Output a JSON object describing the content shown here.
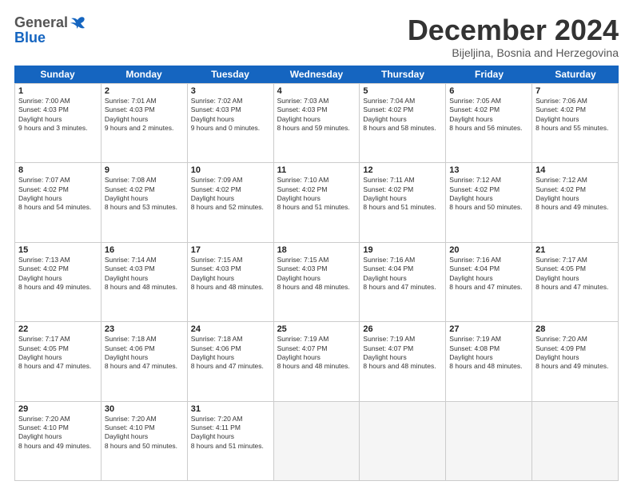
{
  "header": {
    "logo_general": "General",
    "logo_blue": "Blue",
    "month_title": "December 2024",
    "subtitle": "Bijeljina, Bosnia and Herzegovina"
  },
  "days_of_week": [
    "Sunday",
    "Monday",
    "Tuesday",
    "Wednesday",
    "Thursday",
    "Friday",
    "Saturday"
  ],
  "weeks": [
    [
      {
        "day": 1,
        "sunrise": "7:00 AM",
        "sunset": "4:03 PM",
        "daylight": "9 hours and 3 minutes."
      },
      {
        "day": 2,
        "sunrise": "7:01 AM",
        "sunset": "4:03 PM",
        "daylight": "9 hours and 2 minutes."
      },
      {
        "day": 3,
        "sunrise": "7:02 AM",
        "sunset": "4:03 PM",
        "daylight": "9 hours and 0 minutes."
      },
      {
        "day": 4,
        "sunrise": "7:03 AM",
        "sunset": "4:03 PM",
        "daylight": "8 hours and 59 minutes."
      },
      {
        "day": 5,
        "sunrise": "7:04 AM",
        "sunset": "4:02 PM",
        "daylight": "8 hours and 58 minutes."
      },
      {
        "day": 6,
        "sunrise": "7:05 AM",
        "sunset": "4:02 PM",
        "daylight": "8 hours and 56 minutes."
      },
      {
        "day": 7,
        "sunrise": "7:06 AM",
        "sunset": "4:02 PM",
        "daylight": "8 hours and 55 minutes."
      }
    ],
    [
      {
        "day": 8,
        "sunrise": "7:07 AM",
        "sunset": "4:02 PM",
        "daylight": "8 hours and 54 minutes."
      },
      {
        "day": 9,
        "sunrise": "7:08 AM",
        "sunset": "4:02 PM",
        "daylight": "8 hours and 53 minutes."
      },
      {
        "day": 10,
        "sunrise": "7:09 AM",
        "sunset": "4:02 PM",
        "daylight": "8 hours and 52 minutes."
      },
      {
        "day": 11,
        "sunrise": "7:10 AM",
        "sunset": "4:02 PM",
        "daylight": "8 hours and 51 minutes."
      },
      {
        "day": 12,
        "sunrise": "7:11 AM",
        "sunset": "4:02 PM",
        "daylight": "8 hours and 51 minutes."
      },
      {
        "day": 13,
        "sunrise": "7:12 AM",
        "sunset": "4:02 PM",
        "daylight": "8 hours and 50 minutes."
      },
      {
        "day": 14,
        "sunrise": "7:12 AM",
        "sunset": "4:02 PM",
        "daylight": "8 hours and 49 minutes."
      }
    ],
    [
      {
        "day": 15,
        "sunrise": "7:13 AM",
        "sunset": "4:02 PM",
        "daylight": "8 hours and 49 minutes."
      },
      {
        "day": 16,
        "sunrise": "7:14 AM",
        "sunset": "4:03 PM",
        "daylight": "8 hours and 48 minutes."
      },
      {
        "day": 17,
        "sunrise": "7:15 AM",
        "sunset": "4:03 PM",
        "daylight": "8 hours and 48 minutes."
      },
      {
        "day": 18,
        "sunrise": "7:15 AM",
        "sunset": "4:03 PM",
        "daylight": "8 hours and 48 minutes."
      },
      {
        "day": 19,
        "sunrise": "7:16 AM",
        "sunset": "4:04 PM",
        "daylight": "8 hours and 47 minutes."
      },
      {
        "day": 20,
        "sunrise": "7:16 AM",
        "sunset": "4:04 PM",
        "daylight": "8 hours and 47 minutes."
      },
      {
        "day": 21,
        "sunrise": "7:17 AM",
        "sunset": "4:05 PM",
        "daylight": "8 hours and 47 minutes."
      }
    ],
    [
      {
        "day": 22,
        "sunrise": "7:17 AM",
        "sunset": "4:05 PM",
        "daylight": "8 hours and 47 minutes."
      },
      {
        "day": 23,
        "sunrise": "7:18 AM",
        "sunset": "4:06 PM",
        "daylight": "8 hours and 47 minutes."
      },
      {
        "day": 24,
        "sunrise": "7:18 AM",
        "sunset": "4:06 PM",
        "daylight": "8 hours and 47 minutes."
      },
      {
        "day": 25,
        "sunrise": "7:19 AM",
        "sunset": "4:07 PM",
        "daylight": "8 hours and 48 minutes."
      },
      {
        "day": 26,
        "sunrise": "7:19 AM",
        "sunset": "4:07 PM",
        "daylight": "8 hours and 48 minutes."
      },
      {
        "day": 27,
        "sunrise": "7:19 AM",
        "sunset": "4:08 PM",
        "daylight": "8 hours and 48 minutes."
      },
      {
        "day": 28,
        "sunrise": "7:20 AM",
        "sunset": "4:09 PM",
        "daylight": "8 hours and 49 minutes."
      }
    ],
    [
      {
        "day": 29,
        "sunrise": "7:20 AM",
        "sunset": "4:10 PM",
        "daylight": "8 hours and 49 minutes."
      },
      {
        "day": 30,
        "sunrise": "7:20 AM",
        "sunset": "4:10 PM",
        "daylight": "8 hours and 50 minutes."
      },
      {
        "day": 31,
        "sunrise": "7:20 AM",
        "sunset": "4:11 PM",
        "daylight": "8 hours and 51 minutes."
      },
      null,
      null,
      null,
      null
    ]
  ]
}
